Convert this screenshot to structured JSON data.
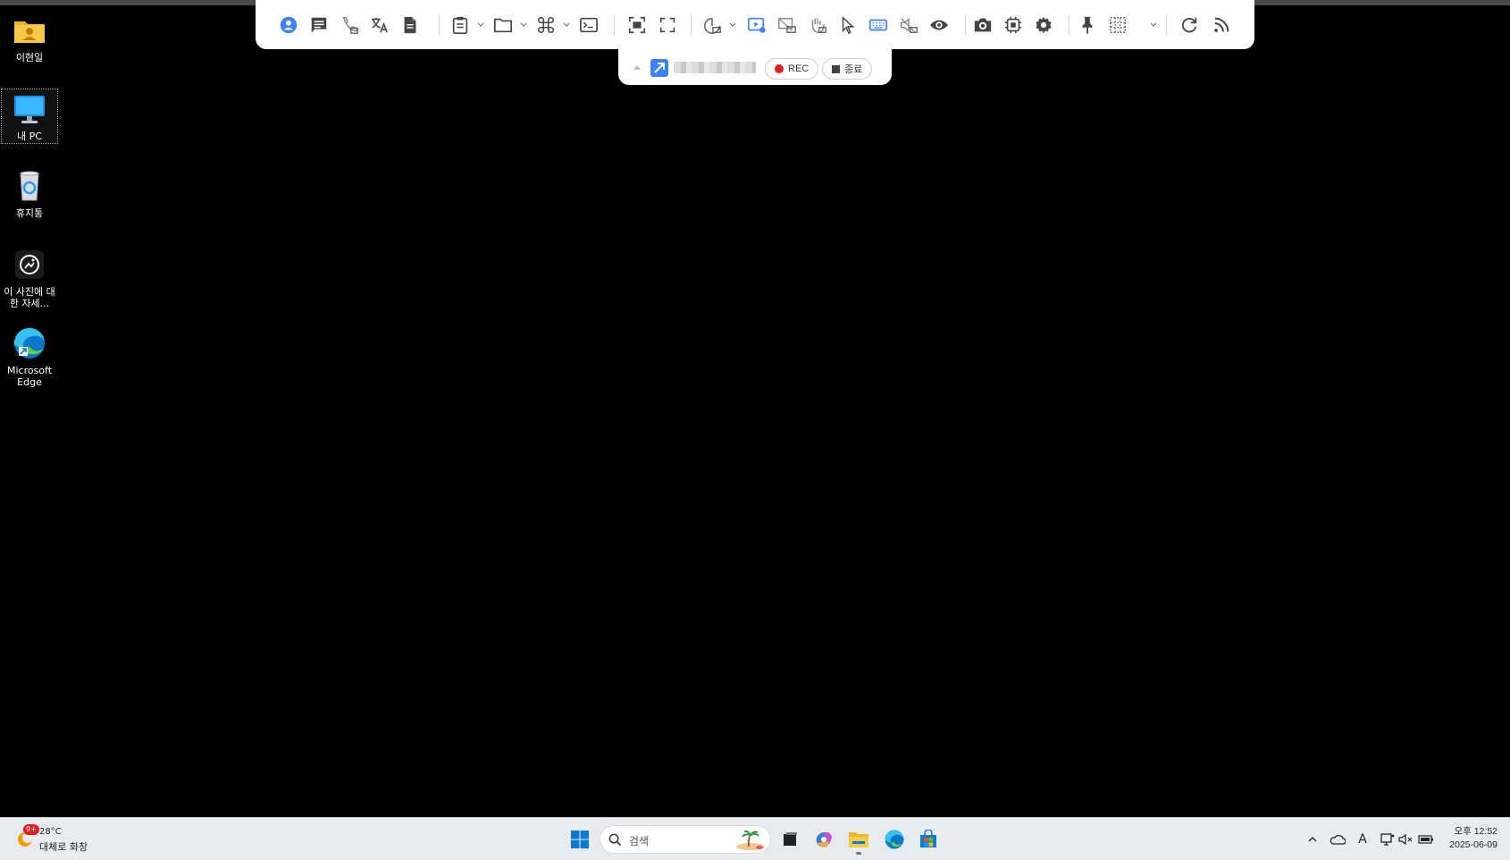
{
  "desktop_icons": [
    {
      "label": "이현일",
      "icon": "user-folder-icon"
    },
    {
      "label": "내 PC",
      "icon": "monitor-icon"
    },
    {
      "label": "휴지통",
      "icon": "recycle-bin-icon"
    },
    {
      "label": "이 사진에 대한 자세...",
      "icon": "photo-info-icon"
    },
    {
      "label": "Microsoft Edge",
      "icon": "edge-icon"
    }
  ],
  "toolbar": {
    "icons": [
      "user-icon",
      "chat-icon",
      "voice-call-icon",
      "translate-icon",
      "document-icon",
      "clipboard-icon",
      "folder-icon",
      "command-icon",
      "terminal-icon",
      "fit-screen-icon",
      "fullscreen-icon",
      "display-icon",
      "remote-play-icon",
      "screen-share-icon",
      "gesture-icon",
      "cursor-icon",
      "keyboard-icon",
      "audio-icon",
      "view-icon",
      "camera-icon",
      "chip-icon",
      "settings-icon",
      "pin-icon",
      "grid-icon",
      "refresh-icon",
      "rss-icon"
    ]
  },
  "session": {
    "rec_label": "REC",
    "stop_label": "종료"
  },
  "taskbar": {
    "weather_badge": "9+",
    "weather_temp": "28°C",
    "weather_desc": "대체로 화창",
    "search_placeholder": "검색",
    "time": "오후 12:52",
    "date": "2025-06-09",
    "ime": "A"
  },
  "colors": {
    "accent": "#3b82f6",
    "rec": "#e02020",
    "windows_blue": "#0a7bd5"
  }
}
